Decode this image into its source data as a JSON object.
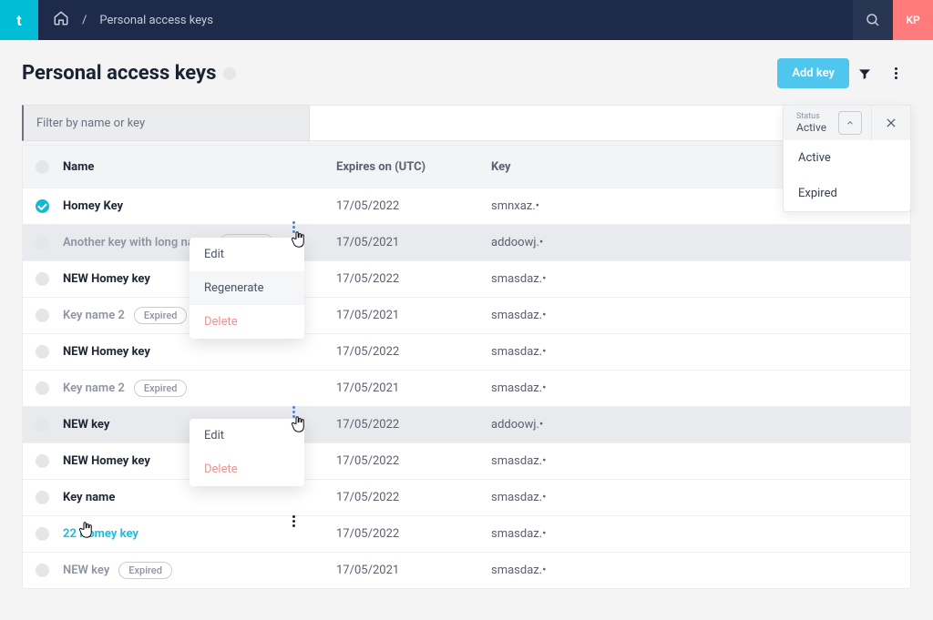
{
  "nav": {
    "brand": "t",
    "breadcrumb_sep": "/",
    "breadcrumb": "Personal access keys",
    "avatar": "KP"
  },
  "page": {
    "title": "Personal access keys",
    "add_button": "Add key",
    "filter_placeholder": "Filter by name or key"
  },
  "status_filter": {
    "label": "Status",
    "value": "Active",
    "options": [
      "Active",
      "Expired"
    ]
  },
  "table": {
    "headers": {
      "name": "Name",
      "expires": "Expires on (UTC)",
      "key": "Key"
    },
    "badge_expired": "Expired",
    "rows": [
      {
        "name": "Homey Key",
        "expires": "17/05/2022",
        "key": "smnxaz.•",
        "checked": true
      },
      {
        "name": "Another key with long name",
        "expires": "17/05/2021",
        "key": "addoowj.•",
        "expired": true,
        "light": true,
        "selected": true
      },
      {
        "name": "NEW Homey key",
        "expires": "17/05/2022",
        "key": "smasdaz.•"
      },
      {
        "name": "Key name 2",
        "expires": "17/05/2021",
        "key": "smasdaz.•",
        "expired": true,
        "light": true
      },
      {
        "name": "NEW Homey key",
        "expires": "17/05/2022",
        "key": "smasdaz.•"
      },
      {
        "name": "Key name 2",
        "expires": "17/05/2021",
        "key": "smasdaz.•",
        "expired": true,
        "light": true
      },
      {
        "name": "NEW key",
        "expires": "17/05/2022",
        "key": "addoowj.•",
        "selected": true
      },
      {
        "name": "NEW Homey key",
        "expires": "17/05/2022",
        "key": "smasdaz.•"
      },
      {
        "name": "Key name",
        "expires": "17/05/2022",
        "key": "smasdaz.•"
      },
      {
        "name": "22 Homey key",
        "expires": "17/05/2022",
        "key": "smasdaz.•",
        "link": true
      },
      {
        "name": "NEW key",
        "expires": "17/05/2021",
        "key": "smasdaz.•",
        "expired": true,
        "light": true
      }
    ]
  },
  "ctx1": {
    "edit": "Edit",
    "regen": "Regenerate",
    "delete": "Delete"
  },
  "ctx2": {
    "edit": "Edit",
    "delete": "Delete"
  }
}
